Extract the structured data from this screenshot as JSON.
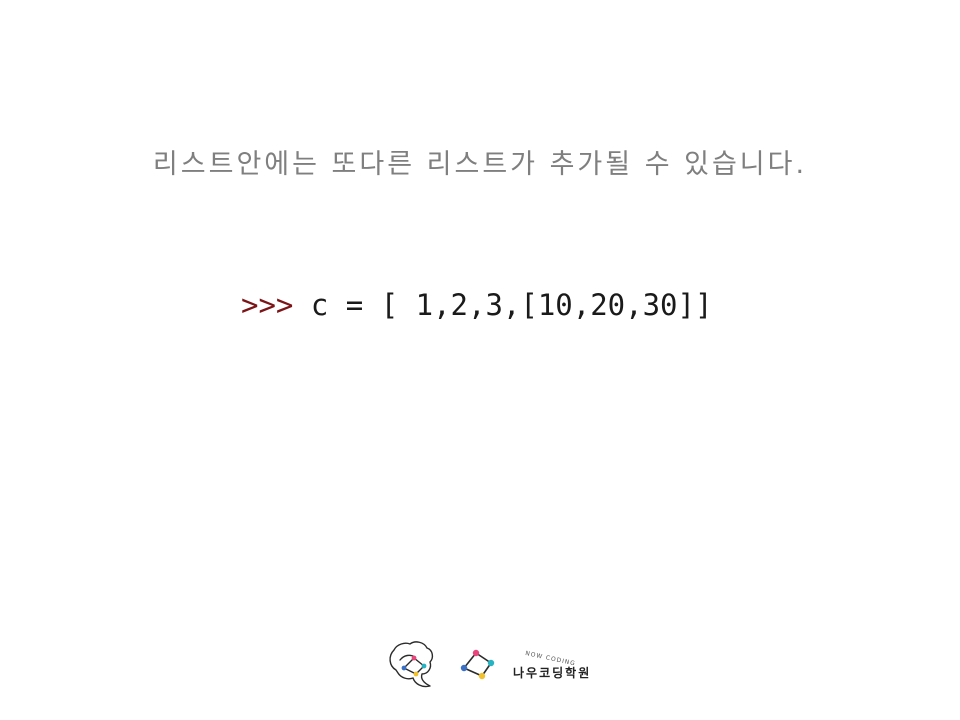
{
  "slide": {
    "heading": "리스트안에는 또다른 리스트가 추가될 수 있습니다.",
    "code": {
      "prompt": ">>>",
      "statement": " c = [ 1,2,3,[10,20,30]]"
    }
  },
  "logo": {
    "tagline": "NOW CODING",
    "brand_name": "나우코딩학원",
    "icons": [
      "brain-icon",
      "network-icon"
    ],
    "colors": {
      "pink": "#e8457c",
      "teal": "#27b3c1",
      "yellow": "#f2c12e",
      "blue": "#3a6fc4",
      "line": "#2b2b2b"
    }
  }
}
